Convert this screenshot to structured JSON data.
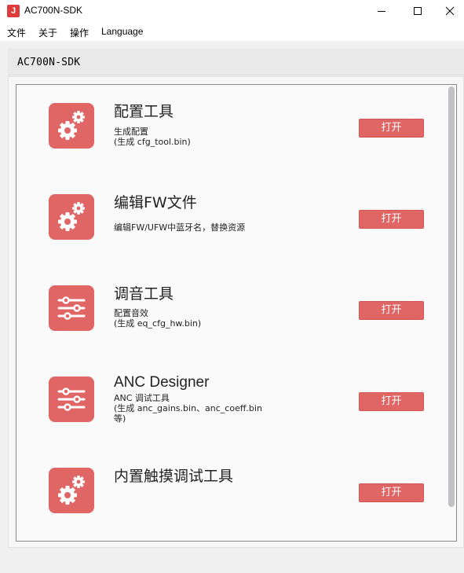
{
  "window": {
    "title": "AC700N-SDK",
    "app_icon": "jl-logo-icon"
  },
  "menu": {
    "items": [
      "文件",
      "关于",
      "操作",
      "Language"
    ]
  },
  "path_label": "AC700N-SDK",
  "accent_color": "#e06565",
  "tools": [
    {
      "title": "配置工具",
      "icon": "gears-icon",
      "desc_lines": [
        "生成配置",
        "(生成 cfg_tool.bin)"
      ],
      "button": "打开"
    },
    {
      "title": "编辑FW文件",
      "icon": "gears-icon",
      "desc_lines": [
        "编辑FW/UFW中蓝牙名，替换资源"
      ],
      "button": "打开"
    },
    {
      "title": "调音工具",
      "icon": "sliders-icon",
      "desc_lines": [
        "配置音效",
        "(生成 eq_cfg_hw.bin)"
      ],
      "button": "打开"
    },
    {
      "title": "ANC Designer",
      "icon": "sliders-icon",
      "desc_lines": [
        "ANC 调试工具",
        "(生成 anc_gains.bin、anc_coeff.bin",
        "等)"
      ],
      "button": "打开"
    },
    {
      "title": "内置触摸调试工具",
      "icon": "gears-icon",
      "desc_lines": [],
      "button": "打开"
    }
  ]
}
